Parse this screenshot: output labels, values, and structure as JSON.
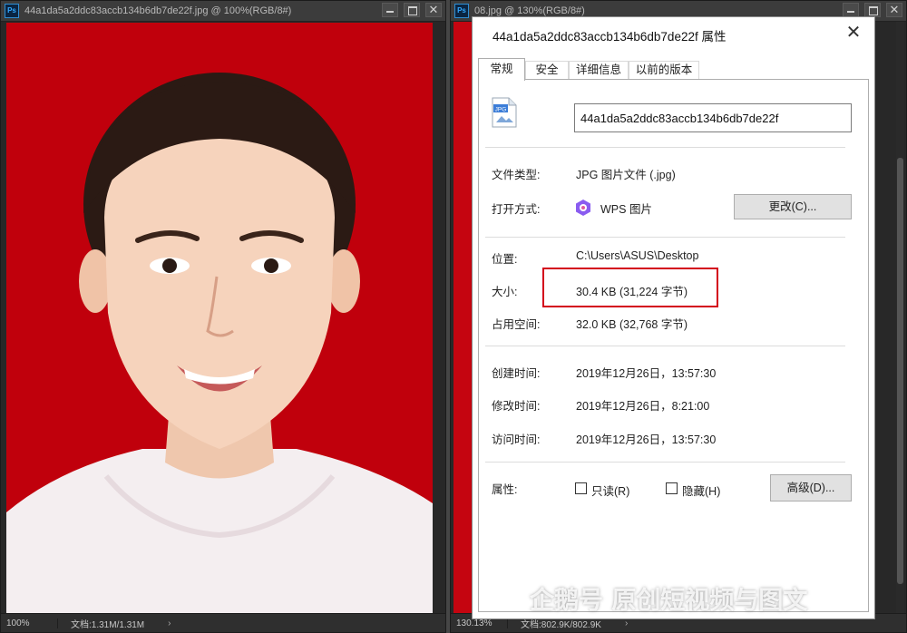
{
  "left_window": {
    "title": "44a1da5a2ddc83accb134b6db7de22f.jpg @ 100%(RGB/8#)",
    "app_badge": "Ps",
    "status_zoom": "100%",
    "status_doc": "文档:1.31M/1.31M",
    "status_arrow": "›"
  },
  "right_window": {
    "title": "08.jpg @ 130%(RGB/8#)",
    "app_badge": "Ps",
    "status_zoom": "130.13%",
    "status_doc": "文档:802.9K/802.9K",
    "status_arrow": "›"
  },
  "dialog": {
    "title": "44a1da5a2ddc83accb134b6db7de22f 属性",
    "close_glyph": "✕",
    "tabs": [
      {
        "label": "常规",
        "active": true
      },
      {
        "label": "安全",
        "active": false
      },
      {
        "label": "详细信息",
        "active": false
      },
      {
        "label": "以前的版本",
        "active": false
      }
    ],
    "file_name": "44a1da5a2ddc83accb134b6db7de22f",
    "file_icon_label": "JPG",
    "type_label": "文件类型:",
    "type_value": "JPG 图片文件 (.jpg)",
    "open_with_label": "打开方式:",
    "open_with_value": "WPS 图片",
    "change_button": "更改(C)...",
    "location_label": "位置:",
    "location_value": "C:\\Users\\ASUS\\Desktop",
    "size_label": "大小:",
    "size_value": "30.4 KB (31,224 字节)",
    "disk_size_label": "占用空间:",
    "disk_size_value": "32.0 KB (32,768 字节)",
    "created_label": "创建时间:",
    "created_value": "2019年12月26日，13:57:30",
    "modified_label": "修改时间:",
    "modified_value": "2019年12月26日，8:21:00",
    "accessed_label": "访问时间:",
    "accessed_value": "2019年12月26日，13:57:30",
    "attributes_label": "属性:",
    "readonly_label": "只读(R)",
    "hidden_label": "隐藏(H)",
    "advanced_button": "高级(D)..."
  },
  "watermark": "企鹅号 原创短视频与图文",
  "colors": {
    "photo_background": "#c0000c",
    "highlight": "#d3001b",
    "ps_chrome": "#3c3c3c"
  },
  "icons": [
    "photoshop-badge-icon",
    "minimize-icon",
    "maximize-icon",
    "close-icon",
    "jpg-file-icon",
    "wps-picture-icon",
    "checkbox-icon",
    "penguin-logo-icon"
  ]
}
